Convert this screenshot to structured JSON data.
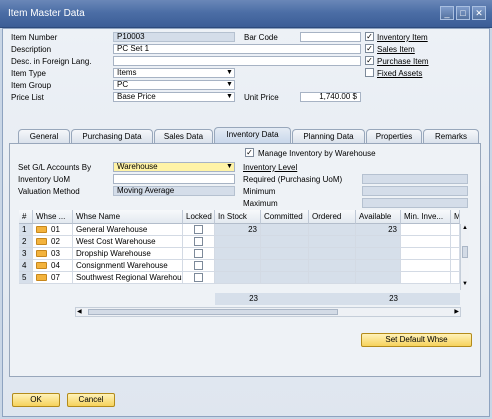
{
  "window": {
    "title": "Item Master Data"
  },
  "header": {
    "item_number_label": "Item Number",
    "item_number": "P10003",
    "bar_code_label": "Bar Code",
    "bar_code": "",
    "description_label": "Description",
    "description": "PC Set 1",
    "foreign_desc_label": "Desc. in Foreign Lang.",
    "foreign_desc": "",
    "item_type_label": "Item Type",
    "item_type": "Items",
    "item_group_label": "Item Group",
    "item_group": "PC",
    "price_list_label": "Price List",
    "price_list": "Base Price",
    "unit_price_label": "Unit Price",
    "unit_price": "1,740.00 $",
    "checks": [
      {
        "label": "Inventory Item",
        "checked": "✓"
      },
      {
        "label": "Sales Item",
        "checked": "✓"
      },
      {
        "label": "Purchase Item",
        "checked": "✓"
      },
      {
        "label": "Fixed Assets",
        "checked": ""
      }
    ]
  },
  "tabs": [
    "General",
    "Purchasing Data",
    "Sales Data",
    "Inventory Data",
    "Planning Data",
    "Properties",
    "Remarks"
  ],
  "inventory": {
    "manage_label": "Manage Inventory by Warehouse",
    "manage_checked": "✓",
    "gl_label": "Set G/L Accounts By",
    "gl_value": "Warehouse",
    "uom_label": "Inventory UoM",
    "uom_value": "",
    "valuation_label": "Valuation Method",
    "valuation_value": "Moving Average",
    "level_label": "Inventory Level",
    "required_label": "Required (Purchasing UoM)",
    "minimum_label": "Minimum",
    "maximum_label": "Maximum"
  },
  "grid": {
    "columns": [
      "#",
      "Whse ...",
      "Whse Name",
      "Locked",
      "In Stock",
      "Committed",
      "Ordered",
      "Available",
      "Min. Inve...",
      "M"
    ],
    "rows": [
      {
        "num": "1",
        "code": "01",
        "name": "General Warehouse",
        "in_stock": "23",
        "available": "23"
      },
      {
        "num": "2",
        "code": "02",
        "name": "West Cost Warehouse",
        "in_stock": "",
        "available": ""
      },
      {
        "num": "3",
        "code": "03",
        "name": "Dropship Warehouse",
        "in_stock": "",
        "available": ""
      },
      {
        "num": "4",
        "code": "04",
        "name": "Consignmentl Warehouse",
        "in_stock": "",
        "available": ""
      },
      {
        "num": "5",
        "code": "07",
        "name": "Southwest Regional Warehous",
        "in_stock": "",
        "available": ""
      }
    ],
    "total_in_stock": "23",
    "total_available": "23"
  },
  "buttons": {
    "set_default": "Set Default Whse",
    "ok": "OK",
    "cancel": "Cancel"
  },
  "titlebar_icons": [
    "minimize-icon",
    "maximize-icon",
    "close-icon"
  ]
}
